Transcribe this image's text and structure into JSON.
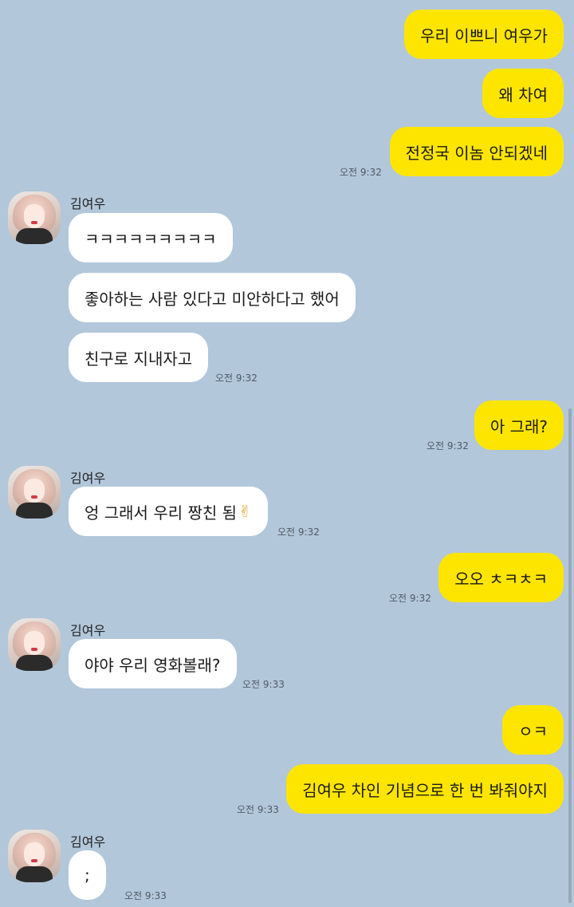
{
  "contact": {
    "name": "김여우"
  },
  "messages": [
    {
      "text": "우리 이쁘니 여우가"
    },
    {
      "text": "왜 차여"
    },
    {
      "text": "전정국 이놈 안되겠네",
      "time": "오전 9:32"
    },
    {
      "text": "ㅋㅋㅋㅋㅋㅋㅋㅋㅋ"
    },
    {
      "text": "좋아하는 사람 있다고 미안하다고 했어"
    },
    {
      "text": "친구로 지내자고",
      "time": "오전 9:32"
    },
    {
      "text": "아 그래?",
      "time": "오전 9:32"
    },
    {
      "text": "엉 그래서 우리 짱친 됨",
      "emoji": "✌",
      "time": "오전 9:32"
    },
    {
      "text": "오오 ㅊㅋㅊㅋ",
      "time": "오전 9:32"
    },
    {
      "text": "야야 우리 영화볼래?",
      "time": "오전 9:33"
    },
    {
      "text": "ㅇㅋ"
    },
    {
      "text": "김여우 차인 기념으로 한 번 봐줘야지",
      "time": "오전 9:33"
    },
    {
      "text": ";",
      "time": "오전 9:33"
    }
  ]
}
